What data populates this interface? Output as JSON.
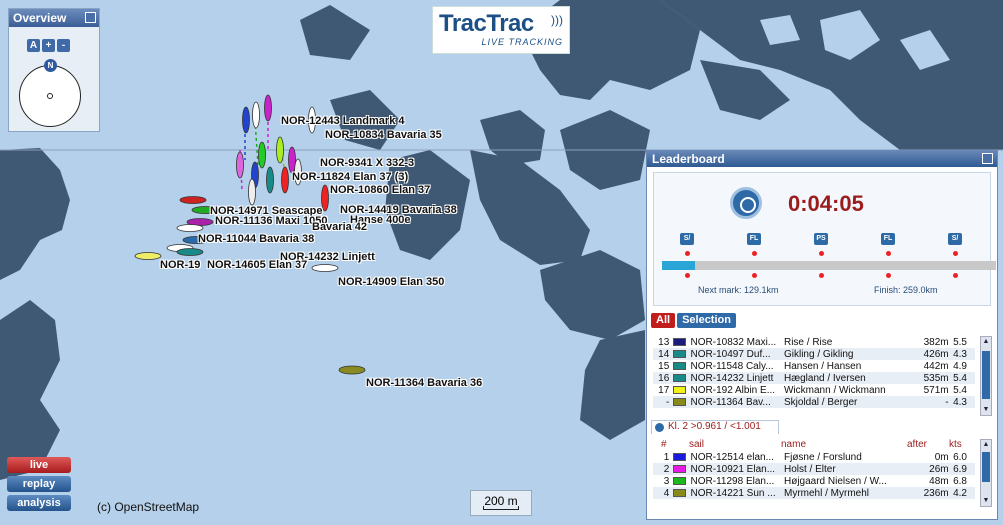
{
  "overview": {
    "title": "Overview",
    "zoom_buttons": [
      "A",
      "+",
      "-"
    ],
    "compass_label": "N"
  },
  "logo": {
    "brand": "TracTrac",
    "tagline": "LIVE TRACKING"
  },
  "map": {
    "attribution": "(c) OpenStreetMap",
    "scale_label": "200 m",
    "labels": [
      "NOR-12443 Landmark 4",
      "NOR-10834 Bavaria 35",
      "NOR-9341 X 332-3",
      "NOR-11824 Elan 37 (3)",
      "NOR-10860 Elan 37",
      "NOR-14971 Seascape",
      "NOR-14419 Bavaria 38",
      "NOR-11136 Maxi 1050",
      "Hanse 400e",
      "Bavaria 42",
      "NOR-11044 Bavaria 38",
      "NOR-14232 Linjett",
      "NOR-19",
      "NOR-14605 Elan 37",
      "NOR-14909 Elan 350",
      "NOR-11364 Bavaria 36"
    ]
  },
  "modes": {
    "live": "live",
    "replay": "replay",
    "analysis": "analysis"
  },
  "leaderboard": {
    "title": "Leaderboard",
    "elapsed": "0:04:05",
    "marks": [
      "S/",
      "FL",
      "PS",
      "FL",
      "S/"
    ],
    "progress_percent": 10,
    "next_mark": "Next mark: 129.1km",
    "finish": "Finish: 259.0km",
    "filter_all": "All",
    "filter_selection": "Selection",
    "overall_rows": [
      {
        "rank": "13",
        "color": "#1a1a7a",
        "sail": "NOR-10832 Maxi...",
        "crew": "Rise / Rise",
        "after": "382m",
        "kts": "5.5"
      },
      {
        "rank": "14",
        "color": "#1a8a88",
        "sail": "NOR-10497 Duf...",
        "crew": "Gikling / Gikling",
        "after": "426m",
        "kts": "4.3"
      },
      {
        "rank": "15",
        "color": "#1a8a88",
        "sail": "NOR-11548 Caly...",
        "crew": "Hansen / Hansen",
        "after": "442m",
        "kts": "4.9"
      },
      {
        "rank": "16",
        "color": "#1a8a88",
        "sail": "NOR-14232 Linjett",
        "crew": "Hægland / Iversen",
        "after": "535m",
        "kts": "5.4"
      },
      {
        "rank": "17",
        "color": "#f2f21a",
        "sail": "NOR-192 Albin E...",
        "crew": "Wickmann / Wickmann",
        "after": "571m",
        "kts": "5.4"
      },
      {
        "rank": "-",
        "color": "#8a8a1a",
        "sail": "NOR-11364 Bav...",
        "crew": "Skjoldal / Berger",
        "after": "-",
        "kts": "4.3"
      }
    ],
    "class_tab": "Kl. 2 >0.961 / <1.001",
    "headers": {
      "num": "#",
      "sail": "sail",
      "name": "name",
      "after": "after",
      "kts": "kts"
    },
    "class_rows": [
      {
        "rank": "1",
        "color": "#1a1adf",
        "sail": "NOR-12514 elan...",
        "crew": "Fjøsne / Forslund",
        "after": "0m",
        "kts": "6.0"
      },
      {
        "rank": "2",
        "color": "#e81ae8",
        "sail": "NOR-10921 Elan...",
        "crew": "Holst / Elter",
        "after": "26m",
        "kts": "6.9"
      },
      {
        "rank": "3",
        "color": "#1ab81a",
        "sail": "NOR-11298 Elan...",
        "crew": "Højgaard Nielsen / W...",
        "after": "48m",
        "kts": "6.8"
      },
      {
        "rank": "4",
        "color": "#8a8a1a",
        "sail": "NOR-14221 Sun ...",
        "crew": "Myrmehl / Myrmehl",
        "after": "236m",
        "kts": "4.2"
      }
    ]
  }
}
